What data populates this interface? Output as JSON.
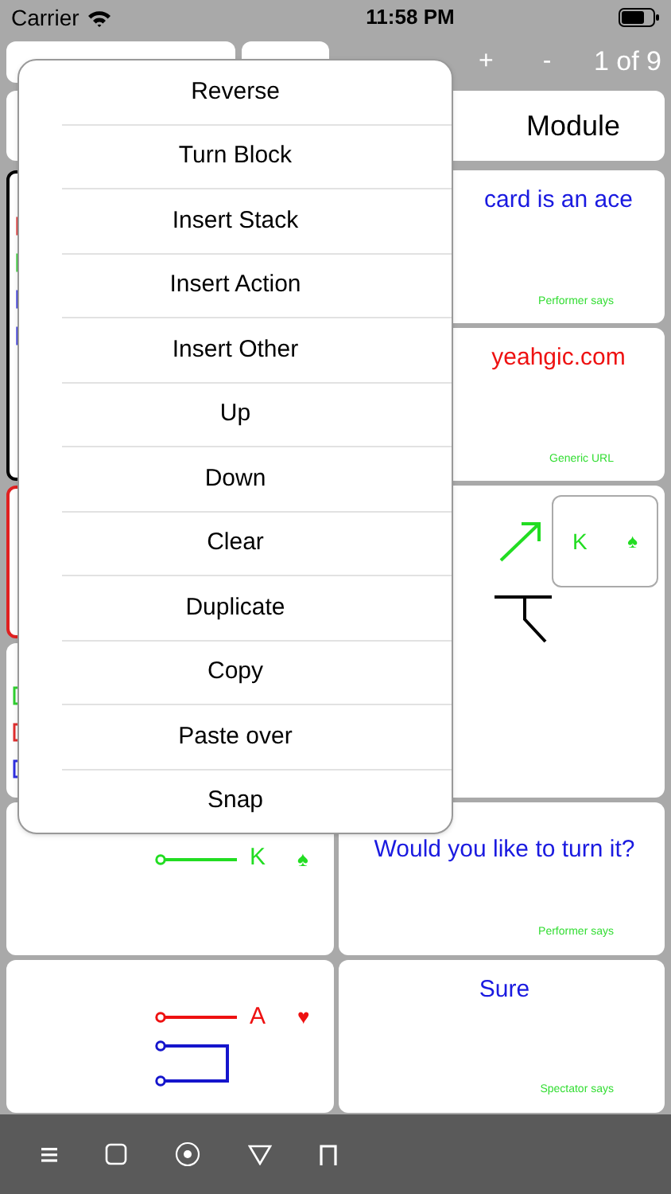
{
  "status_bar": {
    "carrier": "Carrier",
    "time": "11:58 PM"
  },
  "toolbar": {
    "plus": "+",
    "minus": "-",
    "page": "1 of 9"
  },
  "header": {
    "title": "Module"
  },
  "left_cards": [
    {
      "kind": "stack",
      "markers": [
        {
          "color": "#e03030"
        },
        {
          "color": "#30d030"
        },
        {
          "color": "#3030e0"
        },
        {
          "color": "#3030e0"
        }
      ]
    },
    {
      "kind": "block",
      "color": "#e02020"
    },
    {
      "kind": "stack",
      "markers": [
        {
          "color": "#30d030"
        },
        {
          "color": "#e03030"
        },
        {
          "color": "#3030e0"
        }
      ]
    },
    {
      "kind": "line",
      "rank": "K",
      "suit": "♠",
      "color": "#22dd22",
      "loop": false
    },
    {
      "kind": "line",
      "rank": "A",
      "suit": "♥",
      "color": "#ee1111",
      "loop": true
    }
  ],
  "right_cards": [
    {
      "kind": "speech",
      "text": "card is an ace",
      "caption": "Performer says",
      "color": "#1a1ae0"
    },
    {
      "kind": "speech",
      "text": "yeahgic.com",
      "caption": "Generic URL",
      "color": "#ee1111"
    },
    {
      "kind": "drawing",
      "rank": "K",
      "suit": "♠",
      "color": "#22dd22"
    },
    {
      "kind": "speech",
      "text": "Would you like to turn it?",
      "caption": "Performer says",
      "color": "#1a1ae0"
    },
    {
      "kind": "speech",
      "text": "Sure",
      "caption": "Spectator says",
      "color": "#1a1ae0"
    }
  ],
  "menu": {
    "items": [
      "Reverse",
      "Turn Block",
      "Insert Stack",
      "Insert Action",
      "Insert Other",
      "Up",
      "Down",
      "Clear",
      "Duplicate",
      "Copy",
      "Paste over",
      "Snap"
    ]
  }
}
